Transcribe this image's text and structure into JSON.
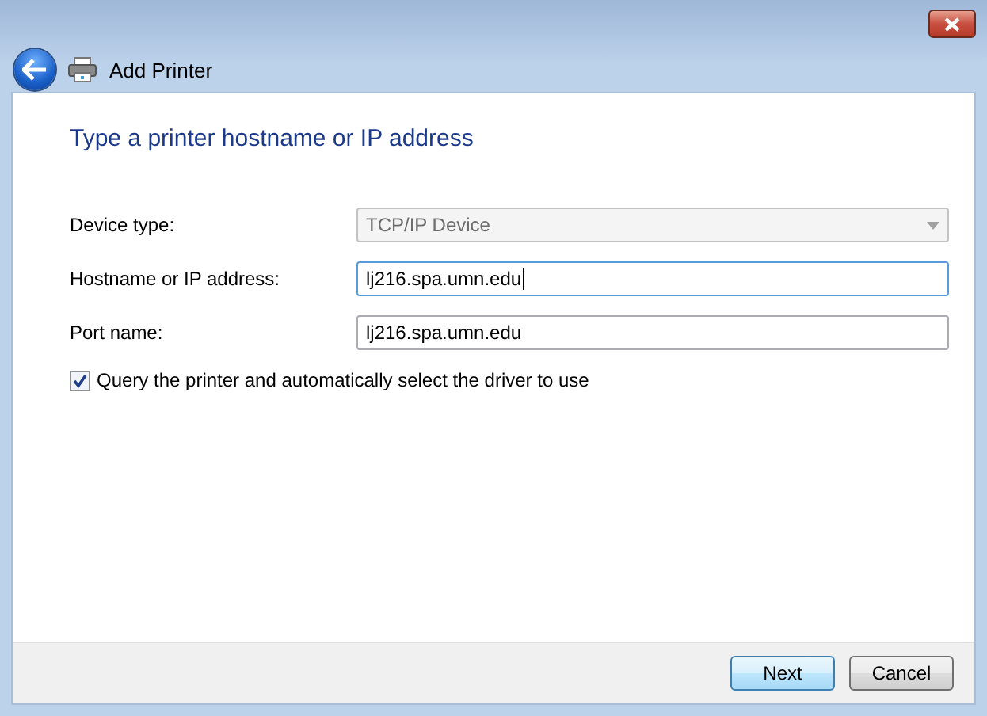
{
  "window": {
    "title": "Add Printer"
  },
  "heading": "Type a printer hostname or IP address",
  "fields": [
    {
      "kind": "dropdown",
      "label": "Device type:",
      "value": "TCP/IP Device",
      "disabled": true,
      "focused": false
    },
    {
      "kind": "text",
      "label": "Hostname or IP address:",
      "value": "lj216.spa.umn.edu",
      "disabled": false,
      "focused": true
    },
    {
      "kind": "text",
      "label": "Port name:",
      "value": "lj216.spa.umn.edu",
      "disabled": false,
      "focused": false
    }
  ],
  "query_option": {
    "label": "Query the printer and automatically select the driver to use",
    "checked": true
  },
  "buttons": [
    {
      "label": "Next",
      "default": true
    },
    {
      "label": "Cancel",
      "default": false
    }
  ]
}
